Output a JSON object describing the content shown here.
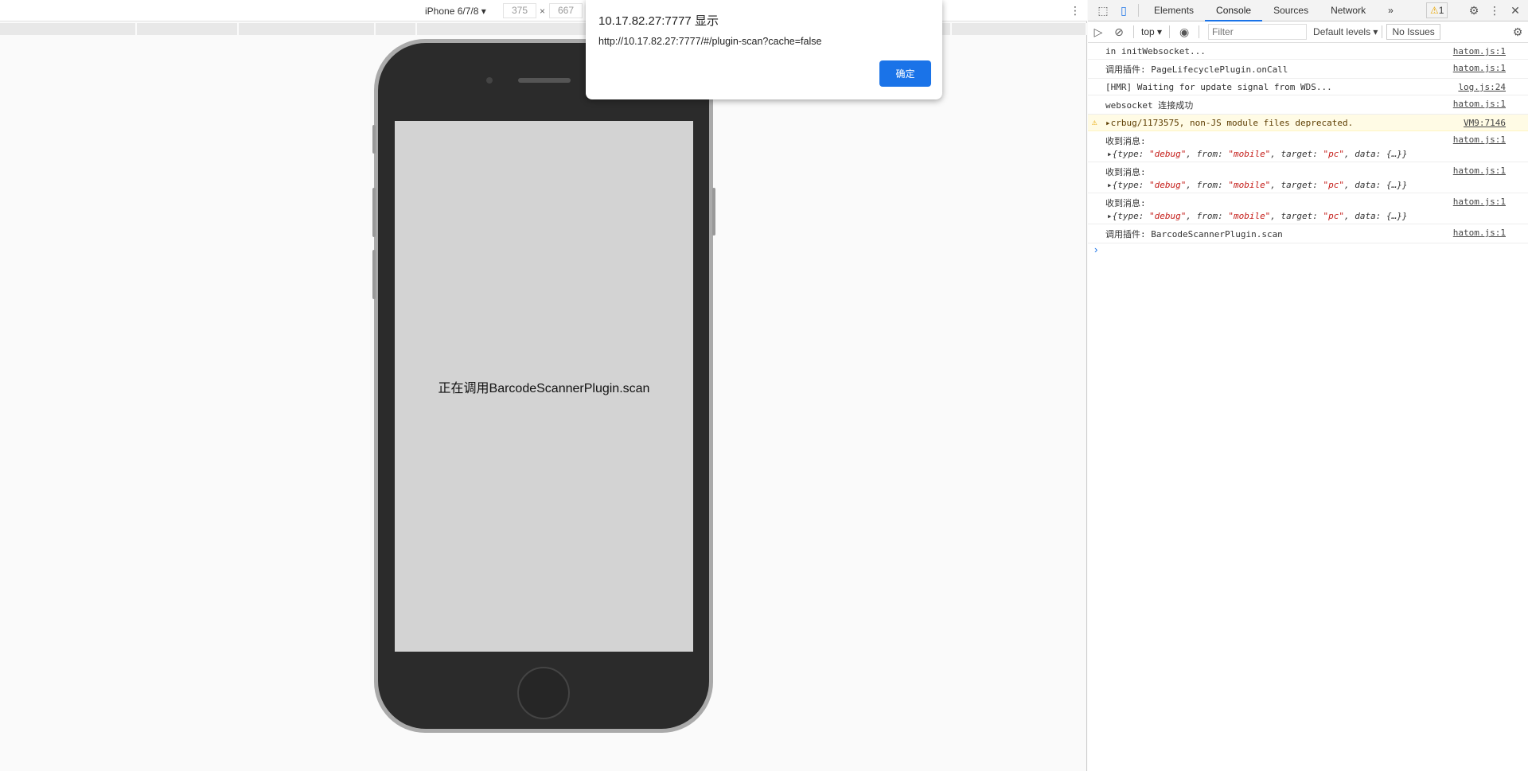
{
  "device_toolbar": {
    "device": "iPhone 6/7/8",
    "width": "375",
    "height": "667",
    "times": "×"
  },
  "page": {
    "status_text": "正在调用BarcodeScannerPlugin.scan"
  },
  "dialog": {
    "title": "10.17.82.27:7777 显示",
    "message": "http://10.17.82.27:7777/#/plugin-scan?cache=false",
    "ok_label": "确定"
  },
  "devtools": {
    "tabs": [
      "Elements",
      "Console",
      "Sources",
      "Network"
    ],
    "active_tab": "Console",
    "more": "»",
    "warning_count": "1",
    "context": "top",
    "filter_placeholder": "Filter",
    "levels": "Default levels",
    "issues": "No Issues",
    "logs": [
      {
        "text": "in initWebsocket...",
        "src": "hatom.js:1"
      },
      {
        "text": "调用插件:  PageLifecyclePlugin.onCall",
        "src": "hatom.js:1"
      },
      {
        "text": "[HMR] Waiting for update signal from WDS...",
        "src": "log.js:24"
      },
      {
        "text": "websocket 连接成功",
        "src": "hatom.js:1"
      },
      {
        "text": "crbug/1173575, non-JS module files deprecated.",
        "src": "VM9:7146",
        "level": "warning"
      },
      {
        "text": "收到消息:",
        "src": "hatom.js:1",
        "obj": true
      },
      {
        "text": "收到消息:",
        "src": "hatom.js:1",
        "obj": true
      },
      {
        "text": "收到消息:",
        "src": "hatom.js:1",
        "obj": true
      },
      {
        "text": "调用插件:  BarcodeScannerPlugin.scan",
        "src": "hatom.js:1"
      }
    ],
    "obj_parts": {
      "k1": "{type: ",
      "v1": "\"debug\"",
      "k2": ", from: ",
      "v2": "\"mobile\"",
      "k3": ", target: ",
      "v3": "\"pc\"",
      "k4": ", data: {…}}"
    }
  },
  "colors": {
    "accent": "#1a73e8",
    "warning_bg": "#fffbe5"
  }
}
